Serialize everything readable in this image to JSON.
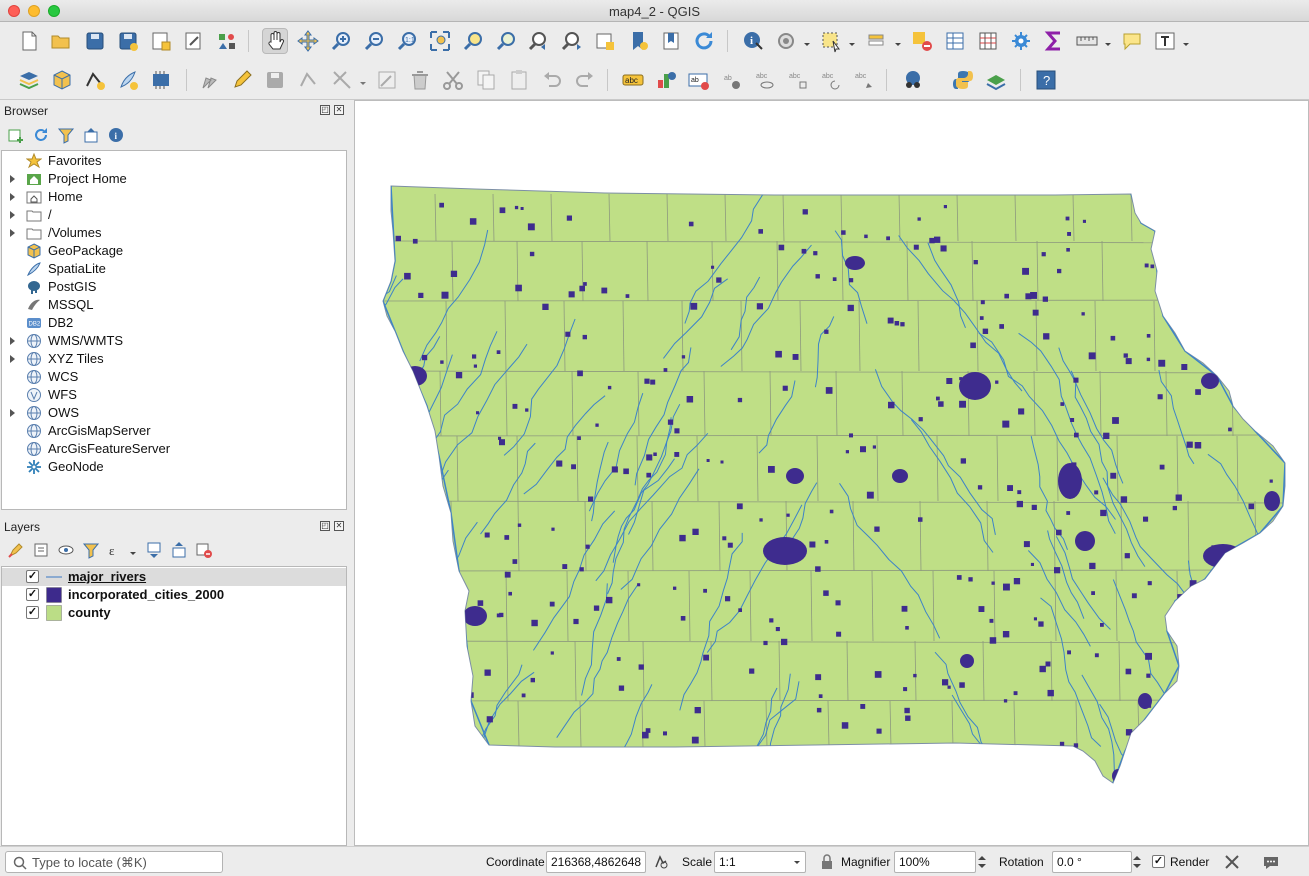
{
  "window": {
    "title": "map4_2 - QGIS"
  },
  "browser": {
    "title": "Browser",
    "items": [
      {
        "label": "Favorites",
        "icon": "star-icon",
        "expandable": false
      },
      {
        "label": "Project Home",
        "icon": "project-home-icon",
        "expandable": true
      },
      {
        "label": "Home",
        "icon": "home-folder-icon",
        "expandable": true
      },
      {
        "label": "/",
        "icon": "folder-icon",
        "expandable": true
      },
      {
        "label": "/Volumes",
        "icon": "folder-icon",
        "expandable": true
      },
      {
        "label": "GeoPackage",
        "icon": "geopackage-icon",
        "expandable": false
      },
      {
        "label": "SpatiaLite",
        "icon": "spatialite-icon",
        "expandable": false
      },
      {
        "label": "PostGIS",
        "icon": "postgis-icon",
        "expandable": false
      },
      {
        "label": "MSSQL",
        "icon": "mssql-icon",
        "expandable": false
      },
      {
        "label": "DB2",
        "icon": "db2-icon",
        "expandable": false
      },
      {
        "label": "WMS/WMTS",
        "icon": "globe-icon",
        "expandable": true
      },
      {
        "label": "XYZ Tiles",
        "icon": "globe-icon",
        "expandable": true
      },
      {
        "label": "WCS",
        "icon": "globe-icon",
        "expandable": false
      },
      {
        "label": "WFS",
        "icon": "wfs-icon",
        "expandable": false
      },
      {
        "label": "OWS",
        "icon": "globe-icon",
        "expandable": true
      },
      {
        "label": "ArcGisMapServer",
        "icon": "globe-icon",
        "expandable": false
      },
      {
        "label": "ArcGisFeatureServer",
        "icon": "globe-icon",
        "expandable": false
      },
      {
        "label": "GeoNode",
        "icon": "geonode-icon",
        "expandable": false
      }
    ]
  },
  "layers": {
    "title": "Layers",
    "items": [
      {
        "name": "major_rivers",
        "checked": true,
        "type": "line",
        "color": "#3a78c4",
        "selected": true
      },
      {
        "name": "incorporated_cities_2000",
        "checked": true,
        "type": "polygon",
        "color": "#3d2a8c",
        "selected": false
      },
      {
        "name": "county",
        "checked": true,
        "type": "polygon",
        "color": "#bbdd86",
        "selected": false
      }
    ]
  },
  "map": {
    "fill_color": "#bfdf86",
    "city_color": "#3e2c8e",
    "river_color": "#3d83c8",
    "border_color": "#8e9a7e"
  },
  "statusbar": {
    "locate_placeholder": "Type to locate (⌘K)",
    "coordinate_label": "Coordinate",
    "coordinate_value": "216368,4862648",
    "scale_label": "Scale",
    "scale_value": "1:1",
    "magnifier_label": "Magnifier",
    "magnifier_value": "100%",
    "rotation_label": "Rotation",
    "rotation_value": "0.0 °",
    "render_label": "Render",
    "render_checked": true
  }
}
